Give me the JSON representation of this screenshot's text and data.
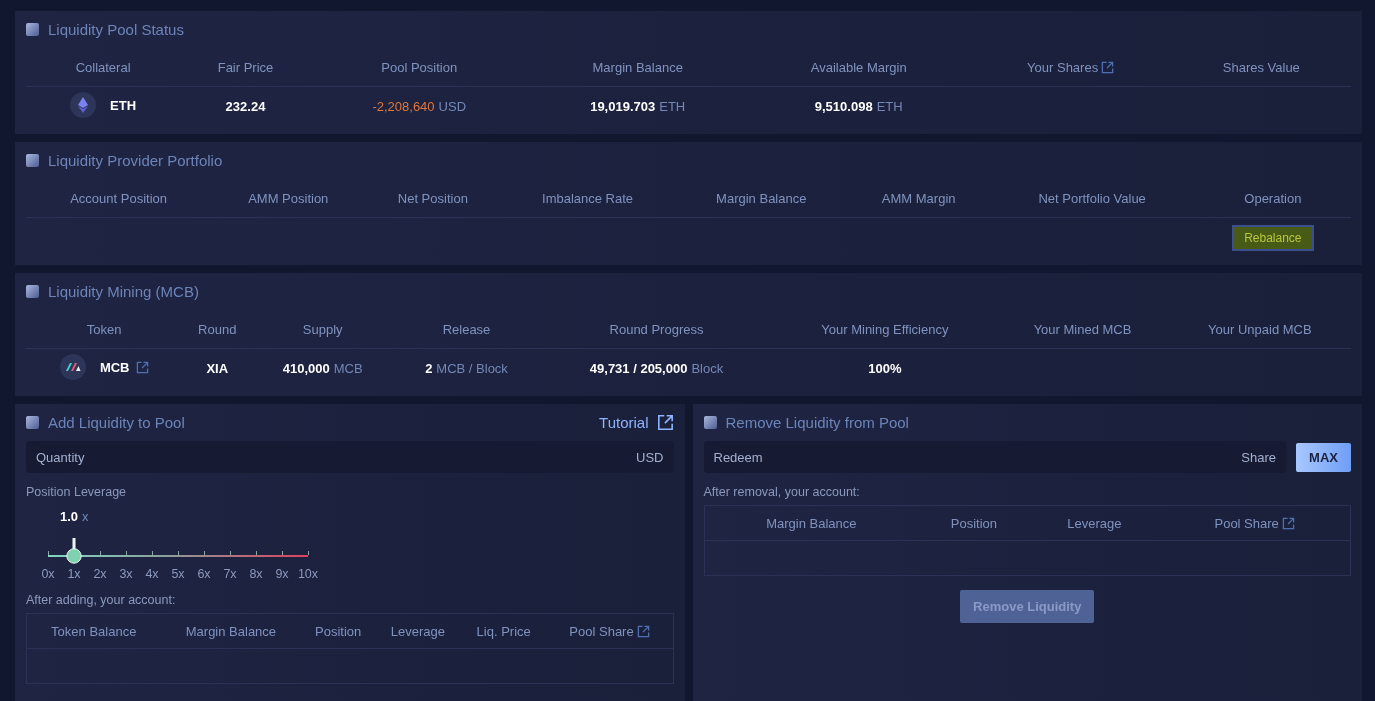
{
  "pool_status": {
    "title": "Liquidity Pool Status",
    "columns": [
      {
        "label": "Collateral"
      },
      {
        "label": "Fair Price"
      },
      {
        "label": "Pool Position"
      },
      {
        "label": "Margin Balance"
      },
      {
        "label": "Available Margin"
      },
      {
        "label": "Your Shares",
        "link": true
      },
      {
        "label": "Shares Value"
      }
    ],
    "rows": [
      [
        {
          "kind": "token",
          "value": "ETH"
        },
        {
          "kind": "value",
          "value": "232.24"
        },
        {
          "kind": "value",
          "value": "-2,208,640",
          "unit": "USD",
          "color": "#e0773a"
        },
        {
          "kind": "value",
          "value": "19,019.703",
          "unit": "ETH"
        },
        {
          "kind": "value",
          "value": "9,510.098",
          "unit": "ETH"
        }
      ]
    ]
  },
  "portfolio": {
    "title": "Liquidity Provider Portfolio",
    "columns": [
      {
        "label": "Account Position"
      },
      {
        "label": "AMM Position"
      },
      {
        "label": "Net Position"
      },
      {
        "label": "Imbalance Rate"
      },
      {
        "label": "Margin Balance"
      },
      {
        "label": "AMM Margin"
      },
      {
        "label": "Net Portfolio Value"
      },
      {
        "label": "Operation"
      }
    ],
    "operation": {
      "label": "Rebalance",
      "highlighted": true
    }
  },
  "mining": {
    "title": "Liquidity Mining (MCB)",
    "columns": [
      {
        "label": "Token"
      },
      {
        "label": "Round"
      },
      {
        "label": "Supply"
      },
      {
        "label": "Release"
      },
      {
        "label": "Round Progress"
      },
      {
        "label": "Your Mining Efficiency"
      },
      {
        "label": "Your Mined MCB"
      },
      {
        "label": "Your Unpaid MCB"
      }
    ],
    "rows": [
      [
        {
          "kind": "token",
          "value": "MCB",
          "link": true
        },
        {
          "kind": "value",
          "value": "XIA"
        },
        {
          "kind": "value",
          "value": "410,000",
          "unit": "MCB"
        },
        {
          "kind": "value",
          "value": "2",
          "unit": "MCB / Block"
        },
        {
          "kind": "value",
          "value": "49,731 / 205,000",
          "unit": "Block"
        },
        {
          "kind": "value",
          "value": "100%"
        }
      ]
    ]
  },
  "add": {
    "title": "Add Liquidity to Pool",
    "tutorial": "Tutorial",
    "quantity": {
      "placeholder": "Quantity",
      "unit": "USD"
    },
    "leverage_label": "Position Leverage",
    "leverage": {
      "value": "1.0",
      "unit": "x",
      "level": 0.1,
      "ticks": [
        "0x",
        "1x",
        "2x",
        "3x",
        "4x",
        "5x",
        "6x",
        "7x",
        "8x",
        "9x",
        "10x"
      ]
    },
    "after_label": "After adding, your account:",
    "columns": [
      {
        "label": "Token Balance"
      },
      {
        "label": "Margin Balance"
      },
      {
        "label": "Position"
      },
      {
        "label": "Leverage"
      },
      {
        "label": "Liq. Price"
      },
      {
        "label": "Pool Share",
        "link": true
      }
    ]
  },
  "remove": {
    "title": "Remove Liquidity from Pool",
    "redeem": {
      "placeholder": "Redeem",
      "unit": "Share"
    },
    "max_button": "MAX",
    "after_label": "After removal, your account:",
    "columns": [
      {
        "label": "Margin Balance"
      },
      {
        "label": "Position"
      },
      {
        "label": "Leverage"
      },
      {
        "label": "Pool Share",
        "link": true
      }
    ],
    "button": {
      "label": "Remove Liquidity",
      "disabled": true
    }
  }
}
